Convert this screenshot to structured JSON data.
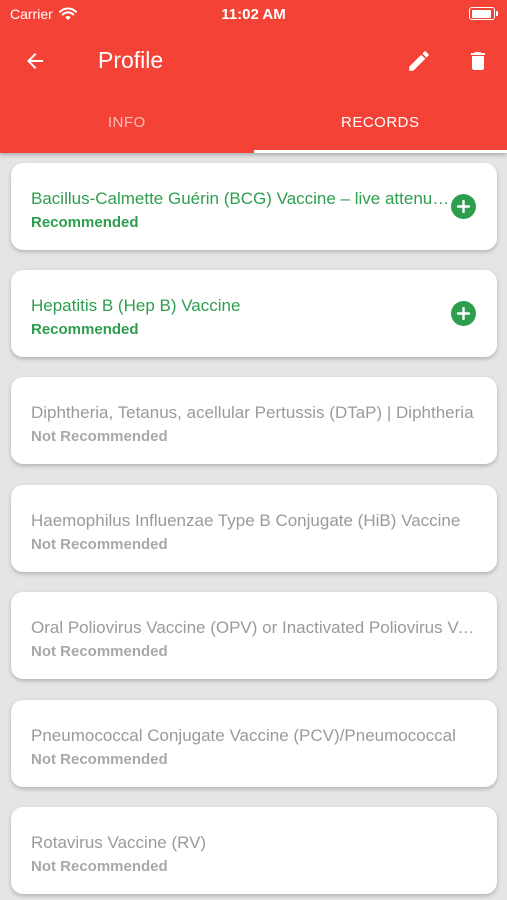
{
  "status_bar": {
    "carrier": "Carrier",
    "time": "11:02 AM"
  },
  "toolbar": {
    "title": "Profile"
  },
  "tabs": [
    {
      "label": "INFO",
      "active": false
    },
    {
      "label": "RECORDS",
      "active": true
    }
  ],
  "records": [
    {
      "name": "Bacillus-Calmette Guérin (BCG) Vaccine – live attenuated",
      "status": "Recommended"
    },
    {
      "name": "Hepatitis B (Hep B) Vaccine",
      "status": "Recommended"
    },
    {
      "name": "Diphtheria, Tetanus, acellular Pertussis (DTaP) | Diphtheria",
      "status": "Not Recommended"
    },
    {
      "name": "Haemophilus Influenzae Type B Conjugate (HiB) Vaccine",
      "status": "Not Recommended"
    },
    {
      "name": "Oral Poliovirus Vaccine (OPV) or Inactivated Poliovirus Vaccine",
      "status": "Not Recommended"
    },
    {
      "name": "Pneumococcal Conjugate Vaccine (PCV)/Pneumococcal",
      "status": "Not Recommended"
    },
    {
      "name": "Rotavirus Vaccine (RV)",
      "status": "Not Recommended"
    }
  ],
  "colors": {
    "primary": "#f44336",
    "recommended": "#2e9e4e",
    "not_recommended": "#9a9a9a",
    "background": "#e5e5e5"
  },
  "icons": {
    "back": "arrow-left-icon",
    "edit": "pencil-icon",
    "delete": "trash-icon",
    "add": "plus-circle-icon",
    "wifi": "wifi-icon",
    "battery": "battery-icon"
  }
}
